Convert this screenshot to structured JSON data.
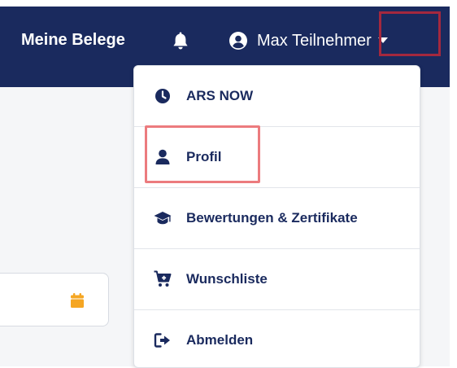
{
  "header": {
    "brand": "Meine Belege",
    "user_name": "Max Teilnehmer"
  },
  "menu": {
    "items": [
      {
        "label": "ARS NOW",
        "icon": "clock-icon"
      },
      {
        "label": "Profil",
        "icon": "user-icon"
      },
      {
        "label": "Bewertungen & Zertifikate",
        "icon": "graduation-cap-icon"
      },
      {
        "label": "Wunschliste",
        "icon": "cart-plus-icon"
      },
      {
        "label": "Abmelden",
        "icon": "sign-out-icon"
      }
    ]
  },
  "colors": {
    "navbar": "#1a2a5e",
    "menu_text": "#1a2a5e",
    "calendar_icon": "#f5a623",
    "annotation_dark": "#a4283e",
    "annotation_pink": "#ec7b7e"
  }
}
